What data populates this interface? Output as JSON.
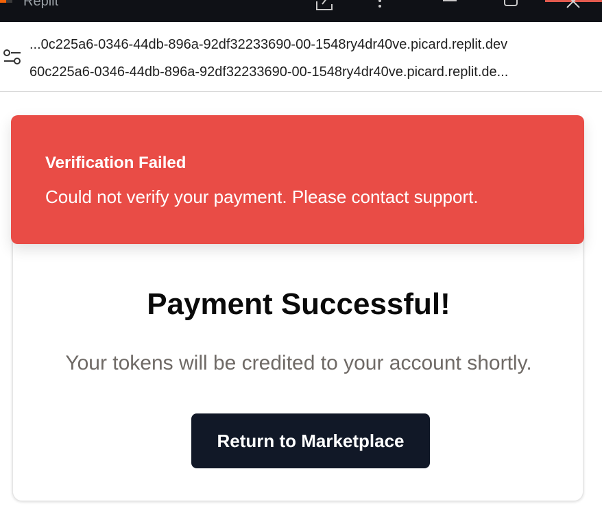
{
  "window": {
    "title": "Replit",
    "accent_color": "#f26207",
    "close_highlight_color": "#e25a4e",
    "icons": [
      "replit-logo-icon",
      "share-icon",
      "more-vert-icon",
      "minimize-icon",
      "maximize-icon",
      "close-icon"
    ]
  },
  "address_bar": {
    "url_short": "...0c225a6-0346-44db-896a-92df32233690-00-1548ry4dr40ve.picard.replit.dev",
    "url_full": "60c225a6-0346-44db-896a-92df32233690-00-1548ry4dr40ve.picard.replit.de...",
    "icon": "site-settings-icon"
  },
  "toast": {
    "title": "Verification Failed",
    "message": "Could not verify your payment. Please contact support.",
    "background_color": "#e94c46"
  },
  "card": {
    "status_icon": "success-ring-icon",
    "status_color": "#3cb55e",
    "title": "Payment Successful!",
    "subtitle": "Your tokens will be credited to your account shortly.",
    "button_label": "Return to Marketplace",
    "button_color": "#111827"
  }
}
